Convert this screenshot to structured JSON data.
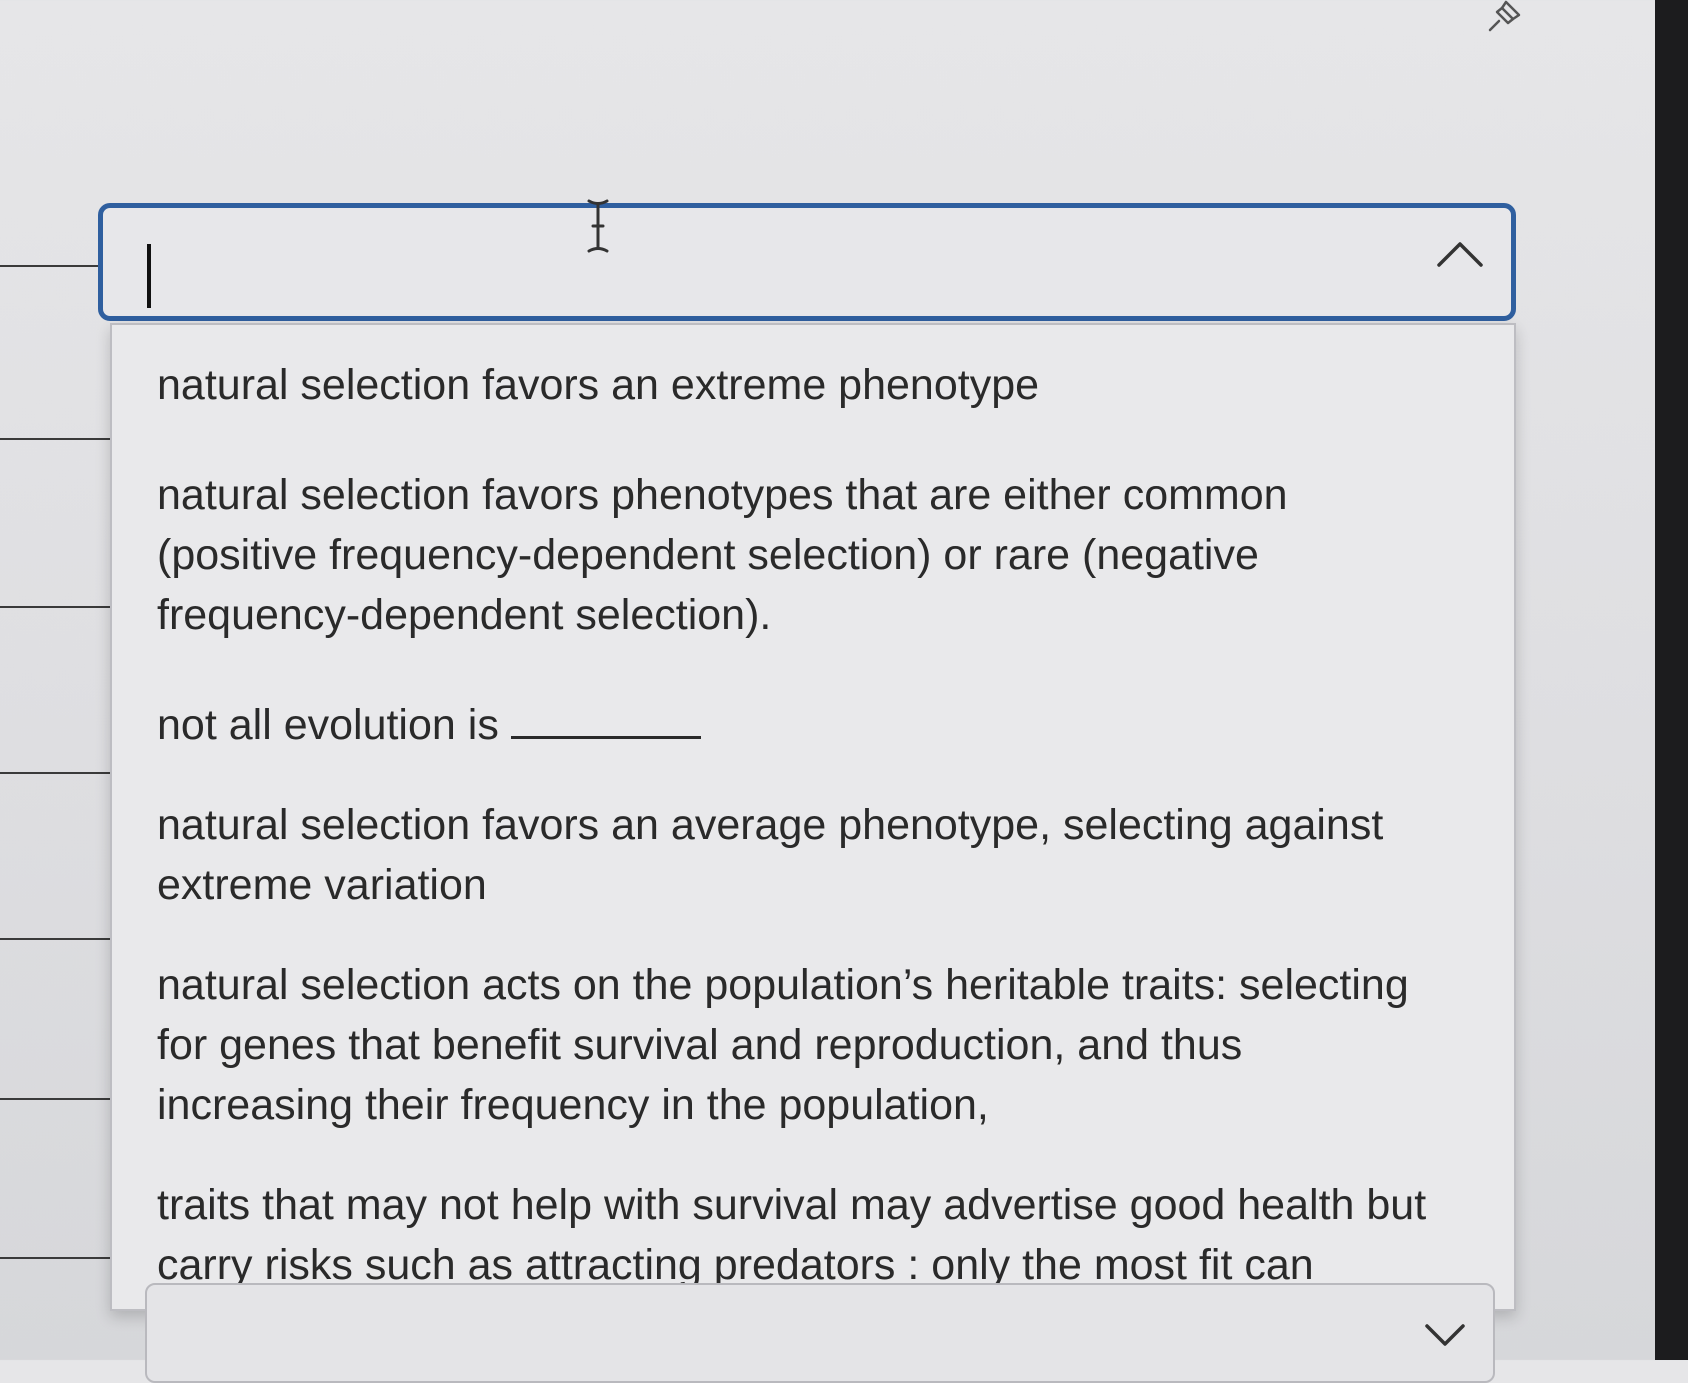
{
  "dropdown": {
    "input_value": "",
    "expanded": true,
    "options": [
      "natural selection favors an extreme phenotype",
      "natural selection favors phenotypes that are either common (positive frequency-dependent selection) or rare (negative frequency-dependent selection).",
      "not all evolution is",
      "natural selection favors an average phenotype, selecting against extreme variation",
      "natural selection acts on the population’s heritable traits: selecting for genes that benefit survival and reproduction, and thus increasing their frequency in the population,",
      "traits that may not help with survival may advertise good health but carry risks such as attracting predators : only the most fit can"
    ]
  },
  "icons": {
    "pin": "pin-icon",
    "toggle_open": "chevron-up-icon",
    "toggle_closed": "chevron-down-icon",
    "text_cursor": "i-beam-cursor-icon"
  },
  "colors": {
    "focus_border": "#2f5f9f",
    "panel_background": "#e9e9eb",
    "text": "#2a2a2a"
  }
}
